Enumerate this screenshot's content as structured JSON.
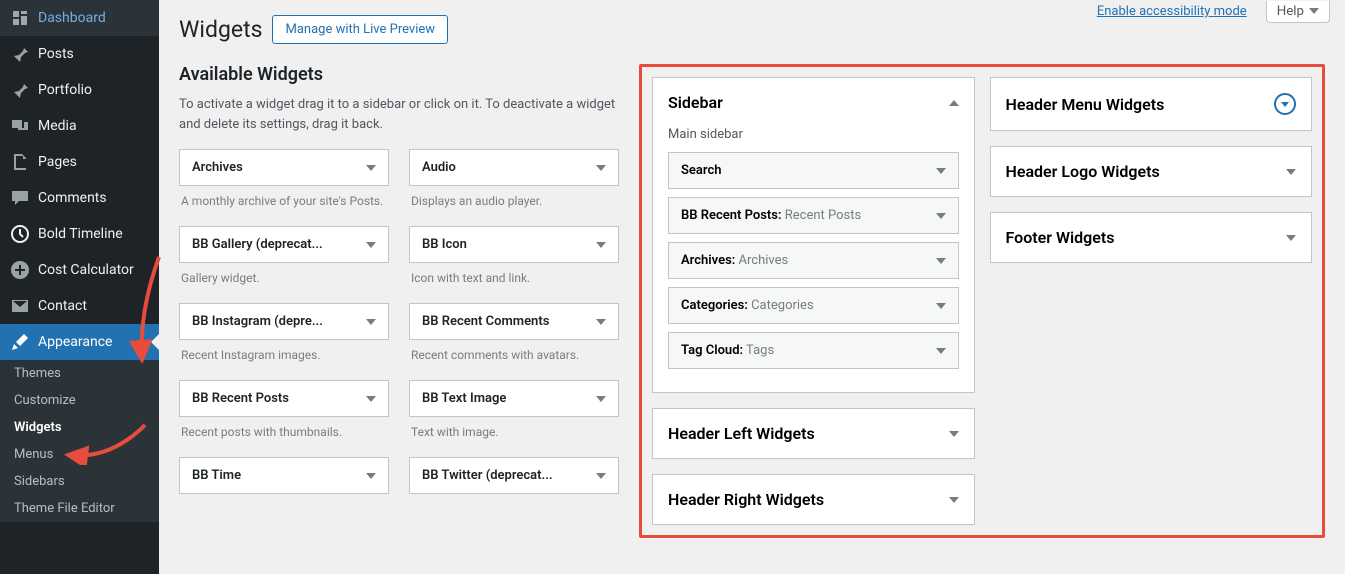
{
  "screen_meta": {
    "accessibility": "Enable accessibility mode",
    "help": "Help"
  },
  "header": {
    "title": "Widgets",
    "button": "Manage with Live Preview"
  },
  "sidebar_menu": [
    {
      "label": "Dashboard",
      "icon": "dashboard"
    },
    {
      "label": "Posts",
      "icon": "pin"
    },
    {
      "label": "Portfolio",
      "icon": "portfolio"
    },
    {
      "label": "Media",
      "icon": "media"
    },
    {
      "label": "Pages",
      "icon": "pages"
    },
    {
      "label": "Comments",
      "icon": "comments"
    },
    {
      "label": "Bold Timeline",
      "icon": "clock"
    },
    {
      "label": "Cost Calculator",
      "icon": "plus"
    },
    {
      "label": "Contact",
      "icon": "mail"
    },
    {
      "label": "Appearance",
      "icon": "brush",
      "active": true
    }
  ],
  "submenu": [
    {
      "label": "Themes"
    },
    {
      "label": "Customize"
    },
    {
      "label": "Widgets",
      "active": true
    },
    {
      "label": "Menus"
    },
    {
      "label": "Sidebars"
    },
    {
      "label": "Theme File Editor"
    }
  ],
  "available": {
    "title": "Available Widgets",
    "desc": "To activate a widget drag it to a sidebar or click on it. To deactivate a widget and delete its settings, drag it back.",
    "widgets": [
      {
        "name": "Archives",
        "desc": "A monthly archive of your site's Posts."
      },
      {
        "name": "Audio",
        "desc": "Displays an audio player."
      },
      {
        "name": "BB Gallery (deprecat...",
        "desc": "Gallery widget."
      },
      {
        "name": "BB Icon",
        "desc": "Icon with text and link."
      },
      {
        "name": "BB Instagram (depre...",
        "desc": "Recent Instagram images."
      },
      {
        "name": "BB Recent Comments",
        "desc": "Recent comments with avatars."
      },
      {
        "name": "BB Recent Posts",
        "desc": "Recent posts with thumbnails."
      },
      {
        "name": "BB Text Image",
        "desc": "Text with image."
      },
      {
        "name": "BB Time",
        "desc": ""
      },
      {
        "name": "BB Twitter (deprecat...",
        "desc": ""
      }
    ]
  },
  "sidebar_areas": {
    "main": {
      "title": "Sidebar",
      "sub": "Main sidebar",
      "items": [
        {
          "name": "Search",
          "ctx": ""
        },
        {
          "name": "BB Recent Posts:",
          "ctx": " Recent Posts"
        },
        {
          "name": "Archives:",
          "ctx": " Archives"
        },
        {
          "name": "Categories:",
          "ctx": " Categories"
        },
        {
          "name": "Tag Cloud:",
          "ctx": " Tags"
        }
      ]
    },
    "left": {
      "title": "Header Left Widgets"
    },
    "right": {
      "title": "Header Right Widgets"
    },
    "menu": {
      "title": "Header Menu Widgets"
    },
    "logo": {
      "title": "Header Logo Widgets"
    },
    "footer": {
      "title": "Footer Widgets"
    }
  }
}
